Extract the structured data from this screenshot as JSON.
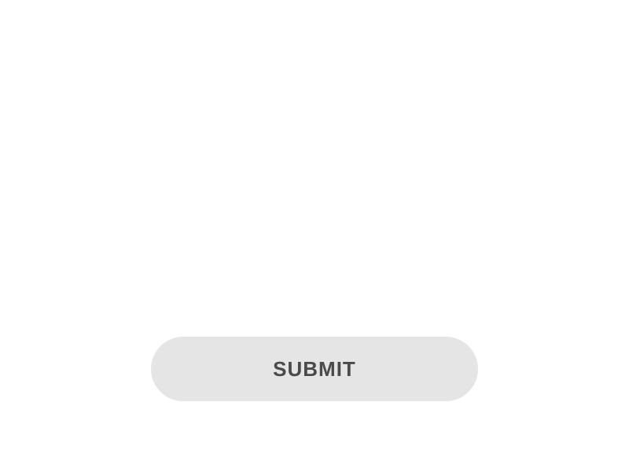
{
  "button": {
    "submit_label": "SUBMIT"
  }
}
